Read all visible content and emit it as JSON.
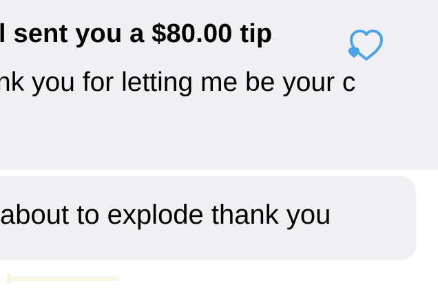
{
  "messages": [
    {
      "tip_text": "l sent you a $80.00 tip",
      "body_text": "nk you for letting me be your c",
      "icon": "heart-icon"
    },
    {
      "body_text": "about to explode thank you"
    }
  ],
  "colors": {
    "bubble_bg": "#f0f0f2",
    "text": "#222222",
    "heart_icon": "#4aa3e8"
  }
}
